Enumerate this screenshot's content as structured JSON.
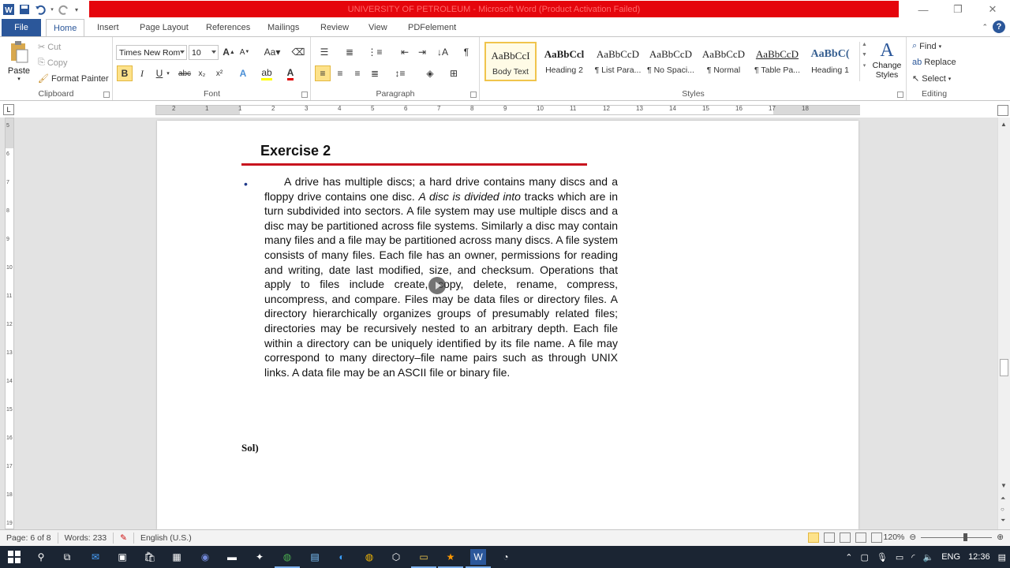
{
  "window": {
    "title": "UNIVERSITY OF PETROLEUM  -  Microsoft Word (Product Activation Failed)"
  },
  "ribbon_tabs": [
    "File",
    "Home",
    "Insert",
    "Page Layout",
    "References",
    "Mailings",
    "Review",
    "View",
    "PDFelement"
  ],
  "clipboard": {
    "paste": "Paste",
    "cut": "Cut",
    "copy": "Copy",
    "format_painter": "Format Painter",
    "label": "Clipboard"
  },
  "font": {
    "family": "Times New Rom",
    "size": "10",
    "label": "Font"
  },
  "paragraph": {
    "label": "Paragraph"
  },
  "styles": {
    "label": "Styles",
    "items": [
      {
        "preview": "AaBbCcI",
        "name": "Body Text"
      },
      {
        "preview": "AaBbCcl",
        "name": "Heading 2"
      },
      {
        "preview": "AaBbCcD",
        "name": "¶ List Para..."
      },
      {
        "preview": "AaBbCcD",
        "name": "¶ No Spaci..."
      },
      {
        "preview": "AaBbCcD",
        "name": "¶ Normal"
      },
      {
        "preview": "AaBbCcD",
        "name": "¶ Table Pa..."
      },
      {
        "preview": "AaBbC(",
        "name": "Heading 1"
      }
    ],
    "change_styles": "Change Styles"
  },
  "editing": {
    "find": "Find",
    "replace": "Replace",
    "select": "Select",
    "label": "Editing"
  },
  "document": {
    "heading": "Exercise 2",
    "para_1": "A drive has multiple discs; a hard drive contains many discs and a floppy drive contains one disc. ",
    "para_italic": "A disc is divided into",
    "para_2": " tracks which are in turn subdivided into sectors. A file system may use multiple discs and a disc may be partitioned across file systems. Similarly a disc may contain many files and a file may be partitioned across many discs. A file system consists of many files. Each file has an owner, permissions for reading and writing, date last modified, size, and checksum. Operations that apply to files include create, copy, delete, rename, compress, uncompress, and compare. Files may be data files or directory files. A directory hierarchically organizes groups of presumably related files; directories may be recursively nested to an arbitrary depth. Each file within a directory can be uniquely identified by its file name. A file may correspond to many directory–file name pairs such as through UNIX links. A data file may be an ASCII file or binary file.",
    "sol": "Sol)"
  },
  "ruler": {
    "numbers": [
      "2",
      "1",
      "1",
      "2",
      "3",
      "4",
      "5",
      "6",
      "7",
      "8",
      "9",
      "10",
      "11",
      "12",
      "13",
      "14",
      "15",
      "16",
      "17",
      "18"
    ]
  },
  "vruler_numbers": [
    "5",
    "6",
    "7",
    "8",
    "9",
    "10",
    "11",
    "12",
    "13",
    "14",
    "15",
    "16",
    "17",
    "18",
    "19"
  ],
  "status": {
    "page": "Page: 6 of 8",
    "words": "Words: 233",
    "language": "English (U.S.)",
    "zoom": "120%"
  },
  "taskbar": {
    "language": "ENG",
    "time": "12:36"
  },
  "colors": {
    "title_bar": "#e5050c",
    "file_tab": "#2b579a",
    "heading_rule": "#c8141e",
    "taskbar": "#1b2533"
  }
}
